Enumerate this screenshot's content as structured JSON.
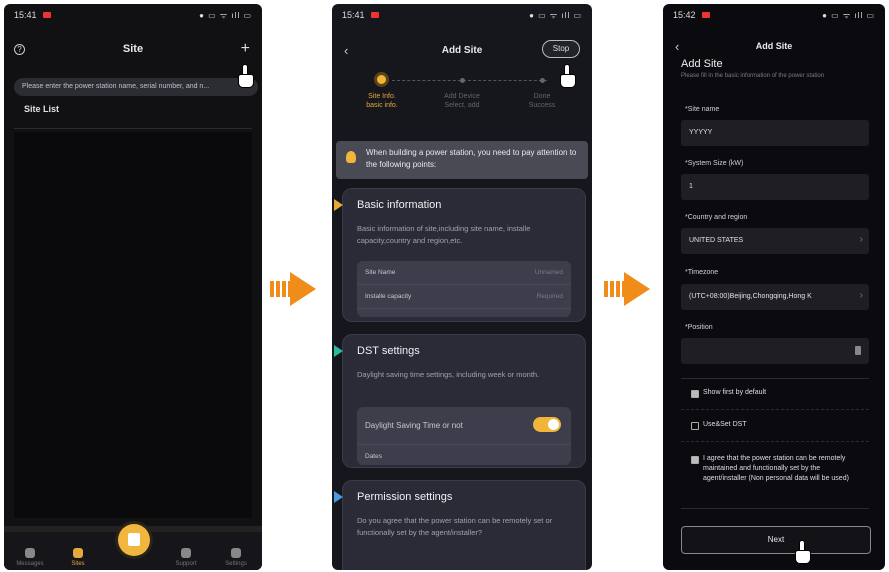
{
  "screen1": {
    "time": "15:41",
    "title": "Site",
    "search_placeholder": "Please enter the power station name, serial number, and n...",
    "site_list_label": "Site List",
    "tabs": [
      "Messages",
      "Sites",
      "",
      "Support",
      "Settings"
    ]
  },
  "screen2": {
    "time": "15:41",
    "title": "Add Site",
    "stop_label": "Stop",
    "steps": [
      {
        "label": "Site Info.",
        "sub": "basic info."
      },
      {
        "label": "Add Device",
        "sub": "Select, add"
      },
      {
        "label": "Done",
        "sub": "Success"
      }
    ],
    "notice": "When building a power station, you need to pay attention to the following points:",
    "basic": {
      "title": "Basic information",
      "desc": "Basic information of site,including site name, installe capacity,country and region,etc.",
      "rows": [
        {
          "label": "Site Name",
          "hint": "Unnamed"
        },
        {
          "label": "Installe capacity",
          "hint": "Required"
        }
      ]
    },
    "dst": {
      "title": "DST settings",
      "desc": "Daylight saving time settings, including week or month.",
      "toggle_label": "Daylight Saving Time or not",
      "row2": "Dates"
    },
    "permission": {
      "title": "Permission settings",
      "desc": "Do you agree that the power station can be remotely set or functionally set by the agent/installer?"
    }
  },
  "screen3": {
    "time": "15:42",
    "header_title": "Add Site",
    "title": "Add Site",
    "subtitle": "Please fill in the basic information of the power station",
    "site_name_label": "*Site name",
    "site_name_value": "YYYYY",
    "system_size_label": "*System Size (kW)",
    "system_size_value": "1",
    "country_label": "*Country and region",
    "country_value": "UNITED STATES",
    "timezone_label": "*Timezone",
    "timezone_value": "(UTC+08:00)Beijing,Chongqing,Hong K",
    "position_label": "*Position",
    "show_first_label": "Show first by default",
    "dst_label": "Use&Set DST",
    "agree_text": "I agree that the power station can be remotely maintained and functionally set by the agent/installer (Non personal data will be used)",
    "next_label": "Next"
  },
  "colors": {
    "accent": "#f1b53a",
    "arrow": "#f08c1a"
  }
}
